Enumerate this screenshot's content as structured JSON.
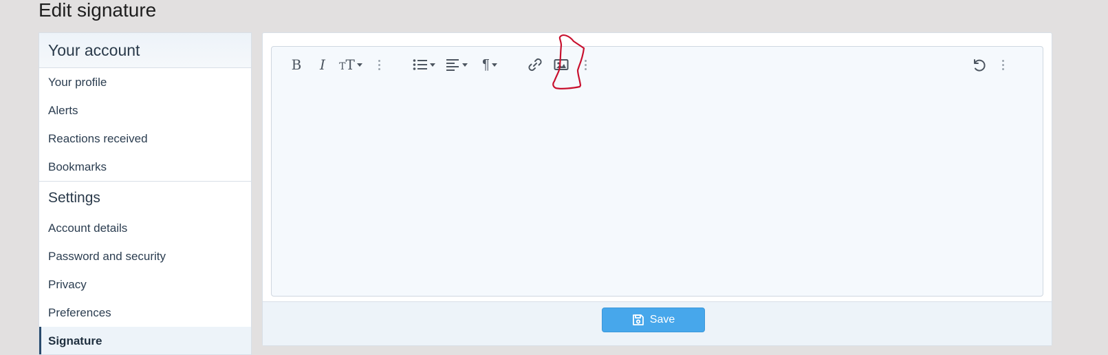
{
  "page": {
    "title": "Edit signature"
  },
  "sidebar": {
    "header": "Your account",
    "items": [
      {
        "label": "Your profile"
      },
      {
        "label": "Alerts"
      },
      {
        "label": "Reactions received"
      },
      {
        "label": "Bookmarks"
      }
    ],
    "settings_heading": "Settings",
    "settings_items": [
      {
        "label": "Account details"
      },
      {
        "label": "Password and security"
      },
      {
        "label": "Privacy"
      },
      {
        "label": "Preferences"
      },
      {
        "label": "Signature",
        "active": true
      }
    ]
  },
  "toolbar": {
    "buttons": [
      {
        "icon": "bold-icon",
        "glyph": "B"
      },
      {
        "icon": "italic-icon",
        "glyph": "I"
      },
      {
        "icon": "text-size-icon",
        "glyph": "TT"
      },
      {
        "icon": "more-options-icon"
      },
      {
        "icon": "list-icon"
      },
      {
        "icon": "align-icon"
      },
      {
        "icon": "paragraph-icon",
        "glyph": "¶"
      },
      {
        "icon": "link-icon"
      },
      {
        "icon": "image-icon"
      },
      {
        "icon": "more-options-icon"
      },
      {
        "icon": "undo-icon"
      },
      {
        "icon": "more-options-icon"
      }
    ]
  },
  "footer": {
    "save_label": "Save"
  },
  "colors": {
    "accent": "#47a7eb",
    "annotation": "#c8102e",
    "background": "#e2e0e0"
  }
}
